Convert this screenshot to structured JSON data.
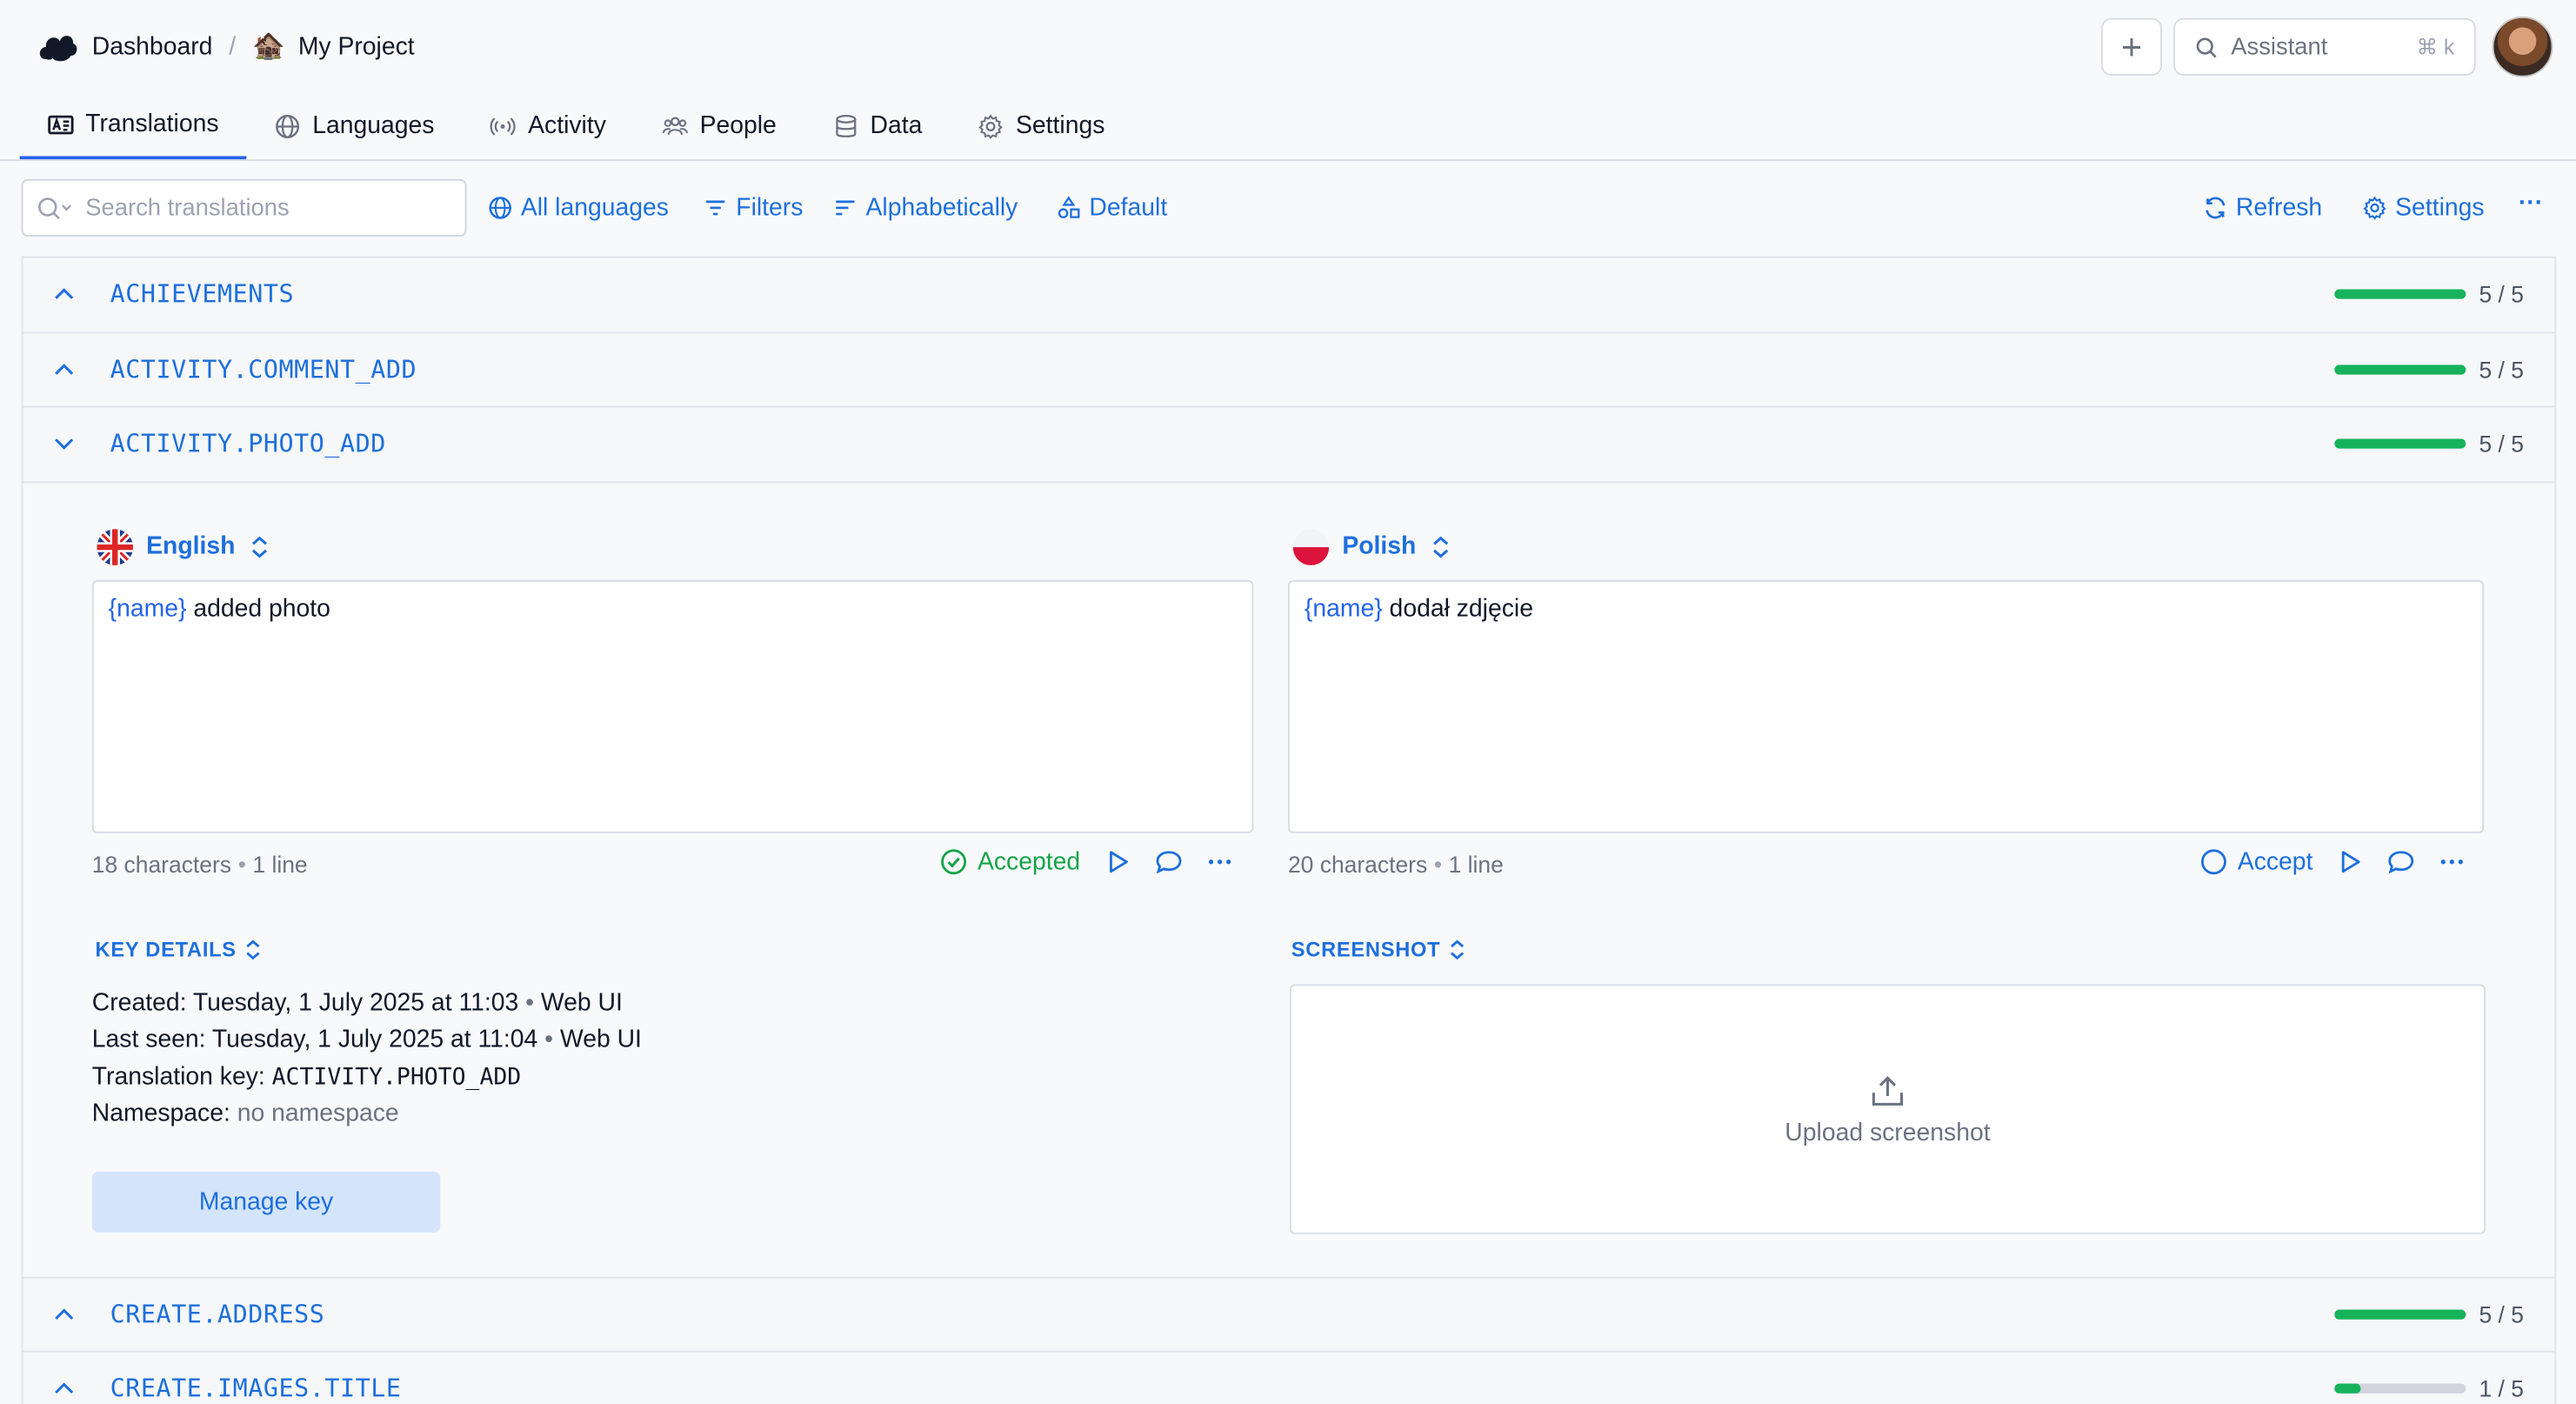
{
  "topbar": {
    "breadcrumb_dashboard": "Dashboard",
    "breadcrumb_sep": "/",
    "project_emoji": "🏚️",
    "project_name": "My Project",
    "add_symbol": "+",
    "assistant_label": "Assistant",
    "assistant_shortcut": "⌘ k"
  },
  "tabs": [
    {
      "label": "Translations",
      "icon": "translation-icon",
      "active": true
    },
    {
      "label": "Languages",
      "icon": "globe-icon"
    },
    {
      "label": "Activity",
      "icon": "broadcast-icon"
    },
    {
      "label": "People",
      "icon": "people-icon"
    },
    {
      "label": "Data",
      "icon": "database-icon"
    },
    {
      "label": "Settings",
      "icon": "gear-icon"
    }
  ],
  "toolbar": {
    "search_placeholder": "Search translations",
    "all_languages": "All languages",
    "filters": "Filters",
    "sort": "Alphabetically",
    "view": "Default",
    "refresh": "Refresh",
    "settings": "Settings",
    "more": "···"
  },
  "colors": {
    "accent": "#1d6fdc",
    "progress": "#16b35a",
    "accepted": "#16a34a"
  },
  "rows_top": [
    {
      "key": "ACHIEVEMENTS",
      "progress": 1.0,
      "count": "5 / 5"
    },
    {
      "key": "ACTIVITY.COMMENT_ADD",
      "progress": 1.0,
      "count": "5 / 5"
    }
  ],
  "expanded_row": {
    "key": "ACTIVITY.PHOTO_ADD",
    "progress": 1.0,
    "count": "5 / 5",
    "source": {
      "language": "English",
      "placeholder": "{name}",
      "text": " added photo",
      "characters": "18 characters",
      "lines": "1 line",
      "status": "Accepted"
    },
    "target": {
      "language": "Polish",
      "placeholder": "{name}",
      "text": " dodał zdjęcie",
      "characters": "20 characters",
      "lines": "1 line",
      "status": "Accept"
    },
    "key_details": {
      "title": "KEY DETAILS",
      "created_label": "Created:",
      "created_value": "Tuesday, 1 July 2025 at 11:03",
      "created_source": "Web UI",
      "last_seen_label": "Last seen:",
      "last_seen_value": "Tuesday, 1 July 2025 at 11:04",
      "last_seen_source": "Web UI",
      "key_label": "Translation key:",
      "key_value": "ACTIVITY.PHOTO_ADD",
      "namespace_label": "Namespace:",
      "namespace_value": "no namespace",
      "manage_button": "Manage key"
    },
    "screenshot": {
      "title": "SCREENSHOT",
      "upload_label": "Upload screenshot"
    }
  },
  "rows_bottom": [
    {
      "key": "CREATE.ADDRESS",
      "progress": 1.0,
      "count": "5 / 5"
    },
    {
      "key": "CREATE.IMAGES.TITLE",
      "progress": 0.2,
      "count": "1 / 5"
    }
  ]
}
